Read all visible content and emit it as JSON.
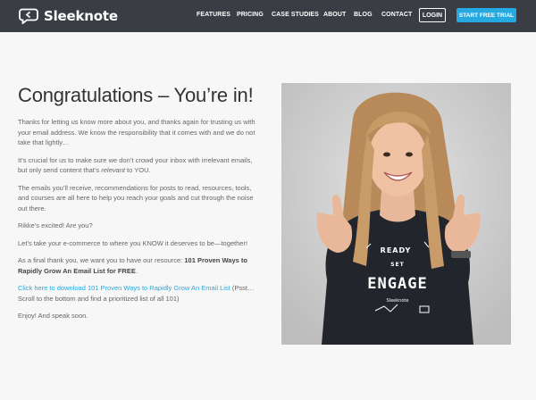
{
  "brand": {
    "name": "Sleeknote"
  },
  "nav": {
    "items": [
      "FEATURES",
      "PRICING",
      "CASE STUDIES",
      "ABOUT",
      "BLOG",
      "CONTACT"
    ],
    "login": "LOGIN",
    "cta": "START FREE TRIAL"
  },
  "colors": {
    "topbar": "#3a3d44",
    "accent": "#26a9e0",
    "background": "#f7f7f7"
  },
  "main": {
    "heading": "Congratulations – You’re in!",
    "p1": "Thanks for letting us know more about you, and thanks again for trusting us with your email address. We know the responsibility that it comes with and we do not take that lightly…",
    "p2_a": "It’s crucial for us to make sure we don’t crowd your inbox with irrelevant emails, but only send content that’s ",
    "p2_em": "relevant",
    "p2_b": " to YOU.",
    "p3": "The emails you’ll receive, recommendations for posts to read, resources, tools, and courses are all here to help you reach your goals and cut through the noise out there.",
    "p4": "Rikke’s excited! Are you?",
    "p5": "Let’s take your e-commerce to where you KNOW it deserves to be—together!",
    "p6_a": "As a final thank you, we want you to have our resource: ",
    "p6_b": "101 Proven Ways to Rapidly Grow An Email List for FREE",
    "p6_c": ".",
    "link": "Click here to download 101 Proven Ways to Rapidly Grow An Email List",
    "p7_after": " (Psst… Scroll to the bottom and find a prioritized list of all 101)",
    "p8": "Enjoy! And speak soon."
  },
  "photo": {
    "shirt_text_1": "READY",
    "shirt_text_2": "SET",
    "shirt_text_3": "ENGAGE",
    "shirt_brand": "Sleeknote"
  }
}
